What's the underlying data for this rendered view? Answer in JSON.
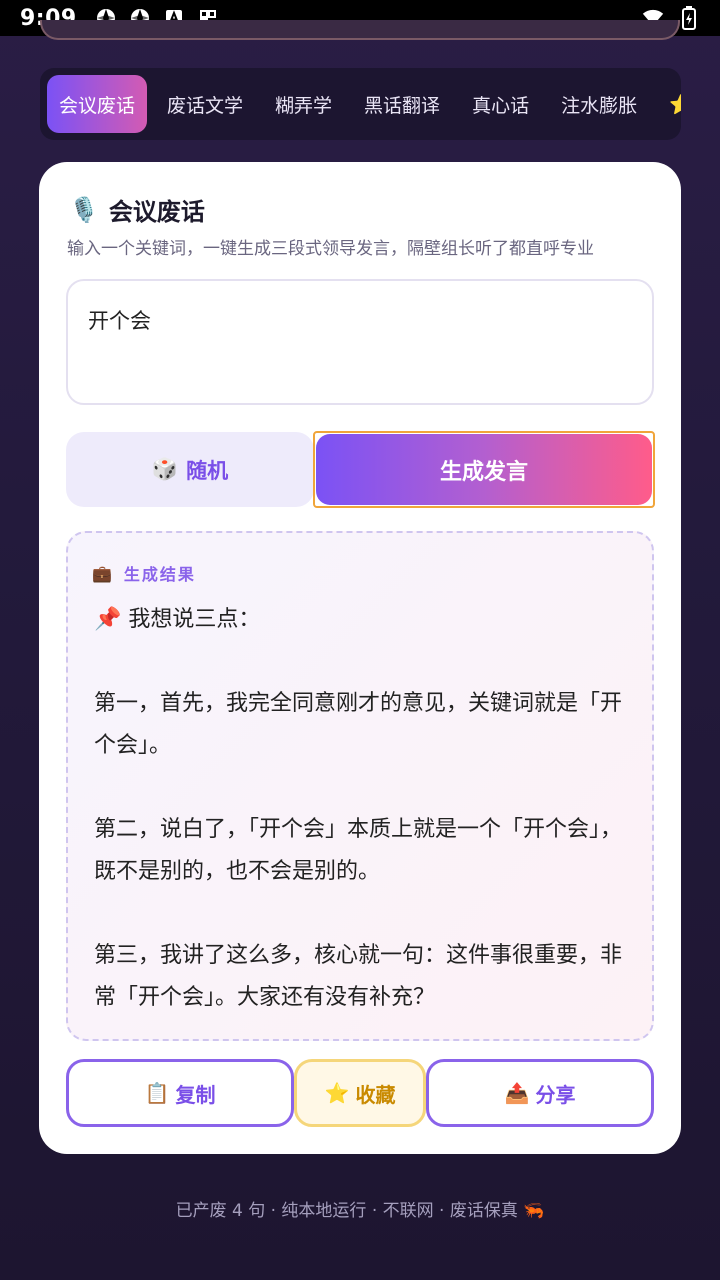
{
  "status_bar": {
    "time": "9:09",
    "left_icons": [
      "pinwheel-icon",
      "pinwheel-icon",
      "font-a-icon",
      "grid-icon"
    ],
    "right_icons": [
      "wifi-icon",
      "battery-icon"
    ]
  },
  "tabs": [
    {
      "label": "会议废话",
      "active": true
    },
    {
      "label": "废话文学",
      "active": false
    },
    {
      "label": "糊弄学",
      "active": false
    },
    {
      "label": "黑话翻译",
      "active": false
    },
    {
      "label": "真心话",
      "active": false
    },
    {
      "label": "注水膨胀",
      "active": false
    }
  ],
  "tabs_overflow_icon": "⭐",
  "card": {
    "title_icon": "🎙️",
    "title": "会议废话",
    "subtitle": "输入一个关键词，一键生成三段式领导发言，隔壁组长听了都直呼专业",
    "input_value": "开个会",
    "random_button": {
      "icon": "🎲",
      "label": "随机"
    },
    "generate_button": {
      "label": "生成发言"
    }
  },
  "result": {
    "header_icon": "💼",
    "header": "生成结果",
    "lines": {
      "intro": "📌 我想说三点：",
      "p1": "第一，首先，我完全同意刚才的意见，关键词就是「开个会」。",
      "p2": "第二，说白了，「开个会」本质上就是一个「开个会」，既不是别的，也不会是别的。",
      "p3": "第三，我讲了这么多，核心就一句：这件事很重要，非常「开个会」。大家还有没有补充？"
    }
  },
  "actions": {
    "copy": {
      "icon": "📋",
      "label": "复制"
    },
    "favorite": {
      "icon": "⭐",
      "label": "收藏"
    },
    "share": {
      "icon": "📤",
      "label": "分享"
    }
  },
  "footer": {
    "text": "已产废 4 句 · 纯本地运行 · 不联网 · 废话保真",
    "icon": "🦐"
  },
  "colors": {
    "accent_purple": "#7b52f5",
    "accent_pink": "#ff5c8a",
    "background": "#231a3c"
  }
}
